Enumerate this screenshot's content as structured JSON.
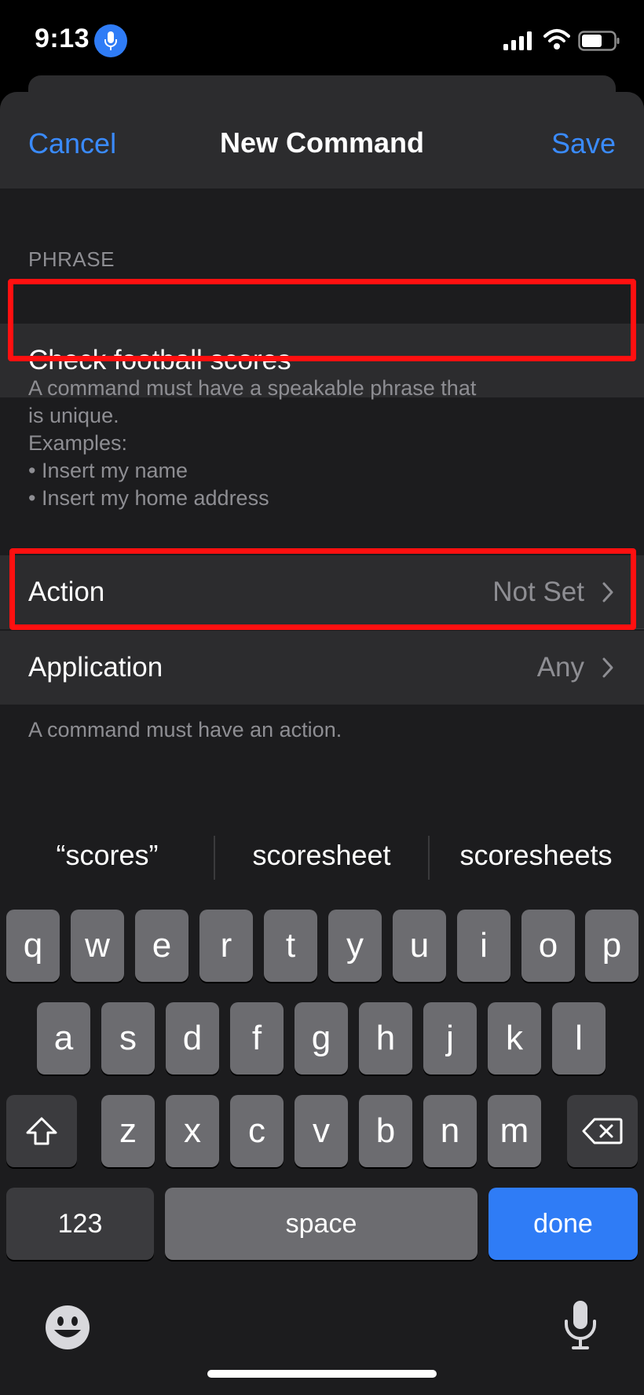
{
  "status_bar": {
    "time": "9:13",
    "icons": [
      "microphone-icon",
      "cellular-signal-icon",
      "wifi-icon",
      "battery-icon"
    ]
  },
  "navbar": {
    "cancel_label": "Cancel",
    "title": "New Command",
    "save_label": "Save",
    "accent_color": "#3a8bff"
  },
  "phrase_section": {
    "header": "PHRASE",
    "value": "Check football scores",
    "footer_lines": [
      "A command must have a speakable phrase that",
      "is unique.",
      "Examples:",
      "• Insert my name",
      "• Insert my home address"
    ]
  },
  "action_section": {
    "rows": [
      {
        "label": "Action",
        "value": "Not Set"
      },
      {
        "label": "Application",
        "value": "Any"
      }
    ],
    "footer": "A command must have an action."
  },
  "keyboard": {
    "suggestions": [
      "“scores”",
      "scoresheet",
      "scoresheets"
    ],
    "row1": [
      "q",
      "w",
      "e",
      "r",
      "t",
      "y",
      "u",
      "i",
      "o",
      "p"
    ],
    "row2": [
      "a",
      "s",
      "d",
      "f",
      "g",
      "h",
      "j",
      "k",
      "l"
    ],
    "row3": [
      "z",
      "x",
      "c",
      "v",
      "b",
      "n",
      "m"
    ],
    "numbers_label": "123",
    "space_label": "space",
    "done_label": "done",
    "done_color": "#2f7cf6"
  },
  "highlight_color": "#ff1010"
}
